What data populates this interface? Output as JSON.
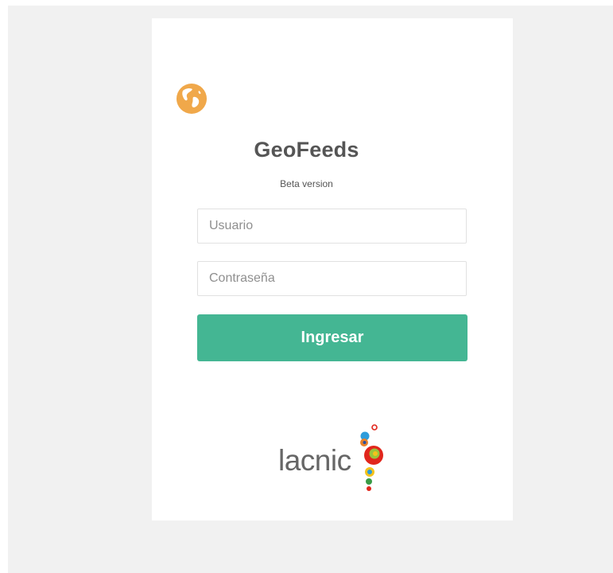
{
  "app": {
    "title": "GeoFeeds",
    "subtitle": "Beta version"
  },
  "login": {
    "username_placeholder": "Usuario",
    "password_placeholder": "Contraseña",
    "submit_label": "Ingresar"
  },
  "footer": {
    "logo_text": "lacnic"
  },
  "icons": {
    "app": "globe-icon"
  },
  "colors": {
    "background": "#f1f1f1",
    "card": "#ffffff",
    "accent": "#44b693",
    "globe": "#f0a84a",
    "text": "#555555"
  }
}
